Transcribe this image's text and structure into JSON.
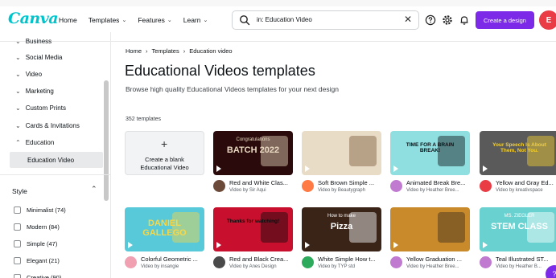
{
  "header": {
    "logo": "Canva",
    "nav": [
      {
        "label": "Home",
        "has_caret": false
      },
      {
        "label": "Templates",
        "has_caret": true
      },
      {
        "label": "Features",
        "has_caret": true
      },
      {
        "label": "Learn",
        "has_caret": true
      }
    ],
    "search_value": "in: Education Video",
    "create_label": "Create a design",
    "avatar_initial": "E",
    "icons": [
      "search-icon",
      "clear-icon",
      "help-icon",
      "settings-icon",
      "bell-icon"
    ]
  },
  "sidebar": {
    "categories": [
      {
        "label": "Business",
        "icon": "chevron-down"
      },
      {
        "label": "Social Media",
        "icon": "chevron-down"
      },
      {
        "label": "Video",
        "icon": "chevron-down"
      },
      {
        "label": "Marketing",
        "icon": "chevron-down"
      },
      {
        "label": "Custom Prints",
        "icon": "chevron-down"
      },
      {
        "label": "Cards & Invitations",
        "icon": "chevron-down"
      },
      {
        "label": "Education",
        "icon": "chevron-up"
      }
    ],
    "selected_sub": "Education Video",
    "style_heading": "Style",
    "style_filters": [
      {
        "label": "Minimalist (74)"
      },
      {
        "label": "Modern (84)"
      },
      {
        "label": "Simple (47)"
      },
      {
        "label": "Elegant (21)"
      },
      {
        "label": "Creative (90)"
      }
    ]
  },
  "main": {
    "breadcrumb": [
      "Home",
      "Templates",
      "Education video"
    ],
    "title": "Educational Videos templates",
    "subtitle": "Browse high quality Educational Videos templates for your next design",
    "count": "352 templates",
    "blank_card": {
      "plus": "+",
      "line1": "Create a blank",
      "line2": "Educational Video"
    },
    "templates": [
      {
        "title": "Red and White Clas...",
        "author": "Video by Sir Aqui",
        "thumb_text": "BATCH 2022",
        "thumb_sub": "Congratulations",
        "bg": "#2a0a0a",
        "accent": "#e8d9c0",
        "avatar": "#6b4a3a"
      },
      {
        "title": "Soft Brown Simple ...",
        "author": "Video by Beautygraph",
        "thumb_text": "",
        "thumb_sub": "",
        "bg": "#e9dcc6",
        "accent": "#7a5a3c",
        "avatar": "#ff7a45"
      },
      {
        "title": "Animated Break Bre...",
        "author": "Video by Heather Bree...",
        "thumb_text": "TIME FOR A BRAIN BREAK!",
        "thumb_sub": "",
        "bg": "#8fdfe0",
        "accent": "#0d1216",
        "avatar": "#c07ad0"
      },
      {
        "title": "Yellow and Gray Ed...",
        "author": "Video by kreativspace",
        "thumb_text": "Your Speech Is About Them, Not You.",
        "thumb_sub": "",
        "bg": "#5a5a5a",
        "accent": "#f5d030",
        "avatar": "#e93c45"
      },
      {
        "title": "Colorful Geometric ...",
        "author": "Video by insangie",
        "thumb_text": "DANIEL GALLEGO",
        "thumb_sub": "",
        "bg": "#57c9d9",
        "accent": "#f7d84a",
        "avatar": "#f0a0b0"
      },
      {
        "title": "Red and Black Crea...",
        "author": "Video by Anes Design",
        "thumb_text": "Thanks for watching!",
        "thumb_sub": "",
        "bg": "#c8102e",
        "accent": "#0d0d0d",
        "avatar": "#4a4a4a"
      },
      {
        "title": "White Simple How t...",
        "author": "Video by TYP std",
        "thumb_text": "Pizza",
        "thumb_sub": "How to make",
        "bg": "#3a2418",
        "accent": "#ffffff",
        "avatar": "#2eaa5c"
      },
      {
        "title": "Yellow Graduation ...",
        "author": "Video by Heather Bree...",
        "thumb_text": "",
        "thumb_sub": "",
        "bg": "#c88a2a",
        "accent": "#3a2a20",
        "avatar": "#c07ad0"
      },
      {
        "title": "Teal Illustrated ST...",
        "author": "Video by Heather B...",
        "thumb_text": "STEM CLASS",
        "thumb_sub": "MS. ZIEGLER",
        "bg": "#69d1cf",
        "accent": "#ffffff",
        "avatar": "#c07ad0"
      }
    ]
  },
  "fab_label": "?",
  "colors": {
    "brand": "#7d2ae8",
    "logo": "#00c4cc"
  }
}
